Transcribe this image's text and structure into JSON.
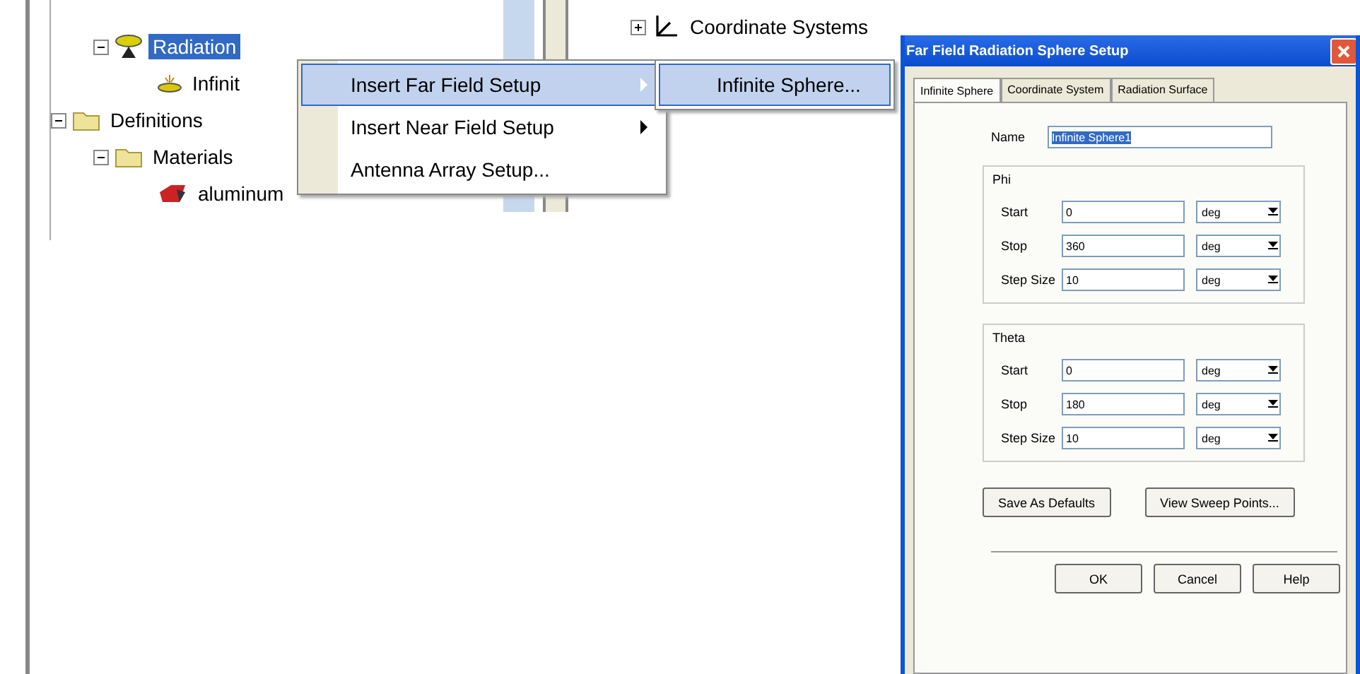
{
  "left_tree": {
    "items": [
      {
        "label": "Radiation",
        "kind": "dish",
        "expanded": true,
        "selected": true,
        "children": [
          {
            "label": "Infinit",
            "kind": "small-dish",
            "selected": false
          }
        ]
      },
      {
        "label": "Definitions",
        "kind": "folder",
        "expanded": true,
        "selected": false,
        "children": [
          {
            "label": "Materials",
            "kind": "folder",
            "expanded": true,
            "selected": false,
            "children": [
              {
                "label": "aluminum",
                "kind": "material",
                "selected": false
              }
            ]
          }
        ]
      }
    ]
  },
  "right_tree": {
    "items": [
      {
        "label": "Coordinate Systems",
        "kind": "axes",
        "expanded": false,
        "selected": false
      }
    ]
  },
  "context_menu": {
    "items": [
      {
        "label": "Insert Far Field Setup",
        "submenu": true,
        "selected": true
      },
      {
        "label": "Insert Near Field Setup",
        "submenu": true,
        "selected": false
      },
      {
        "label": "Antenna Array Setup...",
        "submenu": false,
        "selected": false
      }
    ]
  },
  "submenu": {
    "items": [
      {
        "label": "Infinite Sphere...",
        "selected": true
      }
    ]
  },
  "dialog": {
    "title": "Far Field Radiation Sphere Setup",
    "tabs": [
      {
        "label": "Infinite Sphere",
        "selected": true
      },
      {
        "label": "Coordinate System",
        "selected": false
      },
      {
        "label": "Radiation Surface",
        "selected": false
      }
    ],
    "name": {
      "label": "Name",
      "value": "Infinite Sphere1",
      "text_selected": true
    },
    "groups": [
      {
        "title": "Phi",
        "rows": [
          {
            "label": "Start",
            "value": "0",
            "unit": "deg"
          },
          {
            "label": "Stop",
            "value": "360",
            "unit": "deg"
          },
          {
            "label": "Step Size",
            "value": "10",
            "unit": "deg"
          }
        ]
      },
      {
        "title": "Theta",
        "rows": [
          {
            "label": "Start",
            "value": "0",
            "unit": "deg"
          },
          {
            "label": "Stop",
            "value": "180",
            "unit": "deg"
          },
          {
            "label": "Step Size",
            "value": "10",
            "unit": "deg"
          }
        ]
      }
    ],
    "actions": [
      "Save As Defaults",
      "View Sweep Points..."
    ],
    "buttons": [
      "OK",
      "Cancel",
      "Help"
    ]
  }
}
